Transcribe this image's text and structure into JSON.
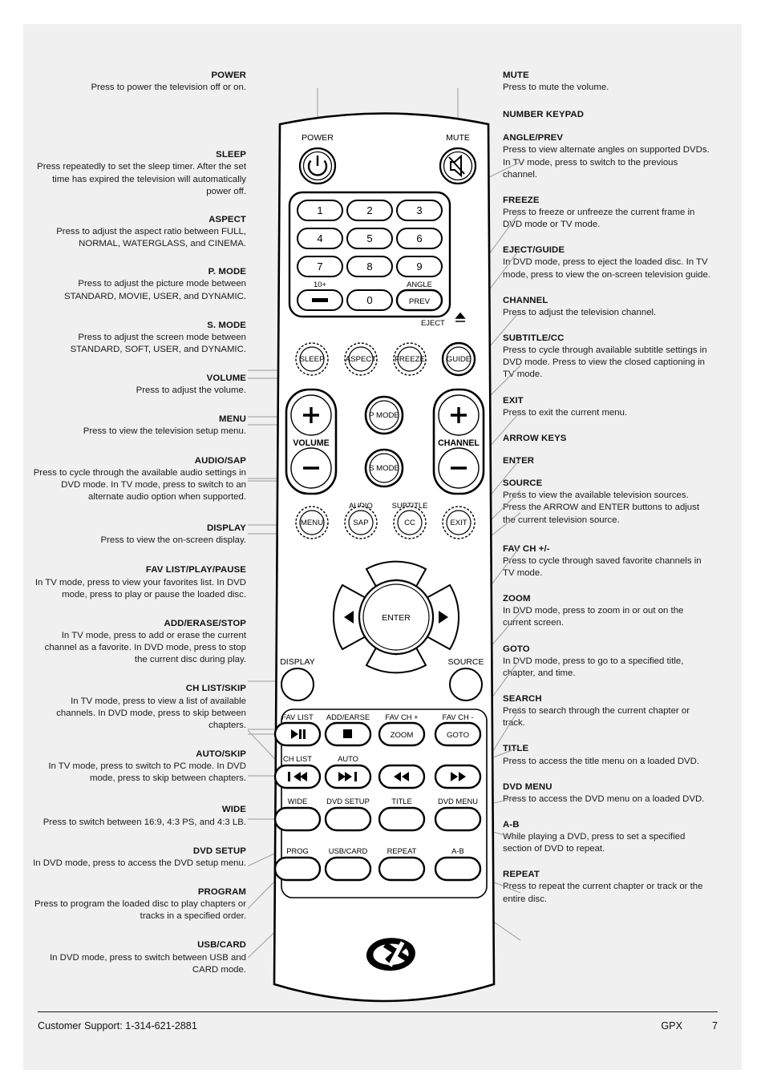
{
  "page": {
    "background": "#f0f0f0",
    "footer": {
      "support": "Customer Support: 1-314-621-2881",
      "brand": "GPX",
      "page_number": "7"
    },
    "logo": "gpx-logo"
  },
  "annotations_left": [
    {
      "title": "POWER",
      "body": "Press to power the television off or on."
    },
    {
      "title": "SLEEP",
      "body": "Press repeatedly to set the sleep timer. After the set time has expired the television will automatically power off."
    },
    {
      "title": "ASPECT",
      "body": "Press to adjust the aspect ratio between FULL, NORMAL, WATERGLASS, and CINEMA."
    },
    {
      "title": "P. MODE",
      "body": "Press to adjust the picture mode between STANDARD, MOVIE, USER, and DYNAMIC."
    },
    {
      "title": "S. MODE",
      "body": "Press to adjust the screen mode between STANDARD, SOFT, USER, and DYNAMIC."
    },
    {
      "title": "VOLUME",
      "body": "Press to adjust the volume."
    },
    {
      "title": "MENU",
      "body": "Press to view the television setup menu."
    },
    {
      "title": "AUDIO/SAP",
      "body": "Press to cycle through the available audio settings in DVD mode.  In TV mode, press to switch to an alternate audio option when supported."
    },
    {
      "title": "DISPLAY",
      "body": "Press to view the on-screen display."
    },
    {
      "title": "FAV LIST/PLAY/PAUSE",
      "body": "In TV mode, press to view your favorites list. In DVD mode, press to play or pause the loaded disc."
    },
    {
      "title": "ADD/ERASE/STOP",
      "body": "In TV mode, press to add or erase the current channel as a favorite. In DVD mode, press to stop the current disc during play."
    },
    {
      "title": "CH LIST/SKIP",
      "body": "In TV mode, press to view a list of available channels. In DVD mode, press to skip between chapters."
    },
    {
      "title": "AUTO/SKIP",
      "body": "In TV mode, press to switch to PC mode.  In DVD mode, press to skip between chapters."
    },
    {
      "title": "WIDE",
      "body": "Press to switch between 16:9, 4:3 PS, and 4:3 LB."
    },
    {
      "title": "DVD SETUP",
      "body": "In DVD mode, press to access the DVD setup menu."
    },
    {
      "title": "PROGRAM",
      "body": "Press to program the loaded disc to play chapters or tracks in a specified order."
    },
    {
      "title": "USB/CARD",
      "body": "In DVD mode, press to switch between USB and CARD mode."
    }
  ],
  "annotations_right": [
    {
      "title": "MUTE",
      "body": "Press to mute the volume."
    },
    {
      "title": "NUMBER KEYPAD",
      "body": ""
    },
    {
      "title": "ANGLE/PREV",
      "body": "Press to view alternate angles on supported DVDs. In TV mode, press to switch to the previous channel."
    },
    {
      "title": "FREEZE",
      "body": "Press to freeze or unfreeze the current frame in DVD mode or TV mode."
    },
    {
      "title": "EJECT/GUIDE",
      "body": "In DVD mode, press to eject the loaded disc. In TV mode, press to view the on-screen television guide."
    },
    {
      "title": "CHANNEL",
      "body": "Press to adjust the television channel."
    },
    {
      "title": "SUBTITLE/CC",
      "body": "Press to cycle through available subtitle settings in DVD mode. Press to view the closed captioning in TV mode."
    },
    {
      "title": "EXIT",
      "body": "Press to exit the current menu."
    },
    {
      "title": "ARROW KEYS",
      "body": ""
    },
    {
      "title": "ENTER",
      "body": ""
    },
    {
      "title": "SOURCE",
      "body": "Press to view the available television sources. Press the ARROW and ENTER buttons to adjust the current television source."
    },
    {
      "title": "FAV CH +/-",
      "body": "Press to cycle through saved favorite channels in TV mode."
    },
    {
      "title": "ZOOM",
      "body": "In DVD mode, press to zoom in or out on the current screen."
    },
    {
      "title": "GOTO",
      "body": "In DVD mode, press to go to a specified title, chapter, and time."
    },
    {
      "title": "SEARCH",
      "body": "Press to search through the current chapter or track."
    },
    {
      "title": "TITLE",
      "body": "Press to access the title menu on a loaded DVD."
    },
    {
      "title": "DVD MENU",
      "body": "Press to access the DVD menu on a loaded DVD."
    },
    {
      "title": "A-B",
      "body": "While playing a DVD, press to set a specified section of DVD to repeat."
    },
    {
      "title": "REPEAT",
      "body": "Press to repeat the current chapter or track or the entire disc."
    }
  ],
  "remote": {
    "top_labels": {
      "power": "POWER",
      "mute": "MUTE"
    },
    "keypad": [
      "1",
      "2",
      "3",
      "4",
      "5",
      "6",
      "7",
      "8",
      "9"
    ],
    "keypad_extra": {
      "ten_plus": "10+",
      "dash": "—",
      "zero": "0"
    },
    "angle_prev": {
      "angle": "ANGLE",
      "prev": "PREV"
    },
    "eject": "EJECT",
    "row_round": [
      "SLEEP",
      "ASPECT",
      "FREEZE",
      "GUIDE"
    ],
    "volume": {
      "label": "VOLUME",
      "plus": "+",
      "minus": "−"
    },
    "channel": {
      "label": "CHANNEL",
      "plus": "+",
      "minus": "−"
    },
    "modes": {
      "p_mode": "P MODE",
      "s_mode": "S MODE"
    },
    "audio_label": "AUDIO",
    "subtitle_label": "SUBTITLE",
    "row_menu": [
      "MENU",
      "SAP",
      "CC",
      "EXIT"
    ],
    "dpad": {
      "enter": "ENTER"
    },
    "display": "DISPLAY",
    "source": "SOURCE",
    "row_fav_labels": [
      "FAV LIST",
      "ADD/EARSE",
      "FAV CH +",
      "FAV CH -"
    ],
    "row_fav_btns": [
      "play-pause-icon",
      "stop-icon",
      "ZOOM",
      "GOTO"
    ],
    "row_chlist_labels": [
      "CH LIST",
      "AUTO",
      "",
      ""
    ],
    "row_chlist_btns": [
      "skip-back-icon",
      "skip-forward-icon",
      "rewind-icon",
      "fast-forward-icon"
    ],
    "row_wide_labels": [
      "WIDE",
      "DVD SETUP",
      "TITLE",
      "DVD MENU"
    ],
    "row_prog_labels": [
      "PROG",
      "USB/CARD",
      "REPEAT",
      "A-B"
    ]
  }
}
